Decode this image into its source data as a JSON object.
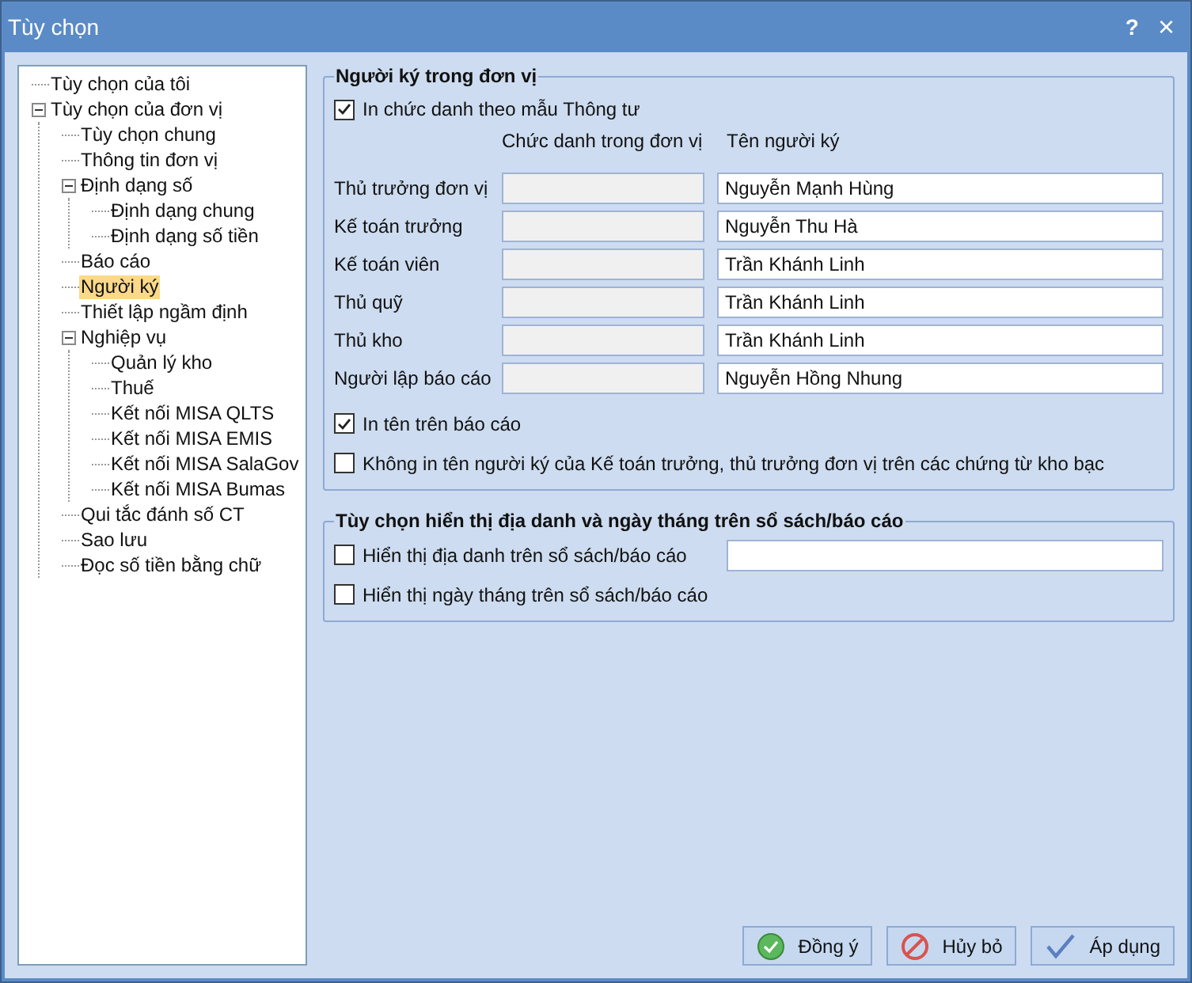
{
  "window": {
    "title": "Tùy chọn",
    "help": "?",
    "close": "×"
  },
  "tree": [
    {
      "label": "Tùy chọn của tôi",
      "selected": false
    },
    {
      "label": "Tùy chọn của đơn vị",
      "selected": false,
      "expanded": true,
      "children": [
        {
          "label": "Tùy chọn chung",
          "selected": false
        },
        {
          "label": "Thông tin đơn vị",
          "selected": false
        },
        {
          "label": "Định dạng số",
          "selected": false,
          "expanded": true,
          "children": [
            {
              "label": "Định dạng chung",
              "selected": false
            },
            {
              "label": "Định dạng số tiền",
              "selected": false
            }
          ]
        },
        {
          "label": "Báo cáo",
          "selected": false
        },
        {
          "label": "Người ký",
          "selected": true
        },
        {
          "label": "Thiết lập ngầm định",
          "selected": false
        },
        {
          "label": "Nghiệp vụ",
          "selected": false,
          "expanded": true,
          "children": [
            {
              "label": "Quản lý kho",
              "selected": false
            },
            {
              "label": "Thuế",
              "selected": false
            },
            {
              "label": "Kết nối MISA QLTS",
              "selected": false
            },
            {
              "label": "Kết nối MISA EMIS",
              "selected": false
            },
            {
              "label": "Kết nối MISA SalaGov",
              "selected": false
            },
            {
              "label": "Kết nối MISA Bumas",
              "selected": false
            }
          ]
        },
        {
          "label": "Qui tắc đánh số CT",
          "selected": false
        },
        {
          "label": "Sao lưu",
          "selected": false
        },
        {
          "label": "Đọc số tiền bằng chữ",
          "selected": false
        }
      ]
    }
  ],
  "signers": {
    "title": "Người ký trong đơn vị",
    "print_title_option": {
      "label": "In chức danh theo mẫu Thông tư",
      "checked": true
    },
    "columns": [
      "Chức danh trong đơn vị",
      "Tên người ký"
    ],
    "rows": [
      {
        "label": "Thủ trưởng đơn vị",
        "name": "Nguyễn Mạnh Hùng"
      },
      {
        "label": "Kế toán trưởng",
        "name": "Nguyễn Thu Hà"
      },
      {
        "label": "Kế toán viên",
        "name": "Trần Khánh Linh"
      },
      {
        "label": "Thủ quỹ",
        "name": "Trần Khánh Linh"
      },
      {
        "label": "Thủ kho",
        "name": "Trần Khánh Linh"
      },
      {
        "label": "Người lập báo cáo",
        "name": "Nguyễn Hồng Nhung"
      }
    ],
    "options": [
      {
        "label": "In tên trên báo cáo",
        "checked": true
      },
      {
        "label": "Không in tên người ký của Kế toán trưởng, thủ trưởng đơn vị trên các chứng từ kho bạc",
        "checked": false
      }
    ]
  },
  "place_date": {
    "title": "Tùy chọn hiển thị địa danh và ngày tháng trên sổ sách/báo cáo",
    "options": [
      {
        "label": "Hiển thị địa danh trên sổ sách/báo cáo",
        "checked": false,
        "kind": "field"
      },
      {
        "label": "Hiển thị ngày tháng trên sổ sách/báo cáo",
        "checked": false,
        "kind": "plain"
      }
    ]
  },
  "buttons": [
    {
      "label": "Đồng ý",
      "kind": "ok"
    },
    {
      "label": "Hủy bỏ",
      "kind": "cancel"
    },
    {
      "label": "Áp dụng",
      "kind": "apply"
    }
  ]
}
